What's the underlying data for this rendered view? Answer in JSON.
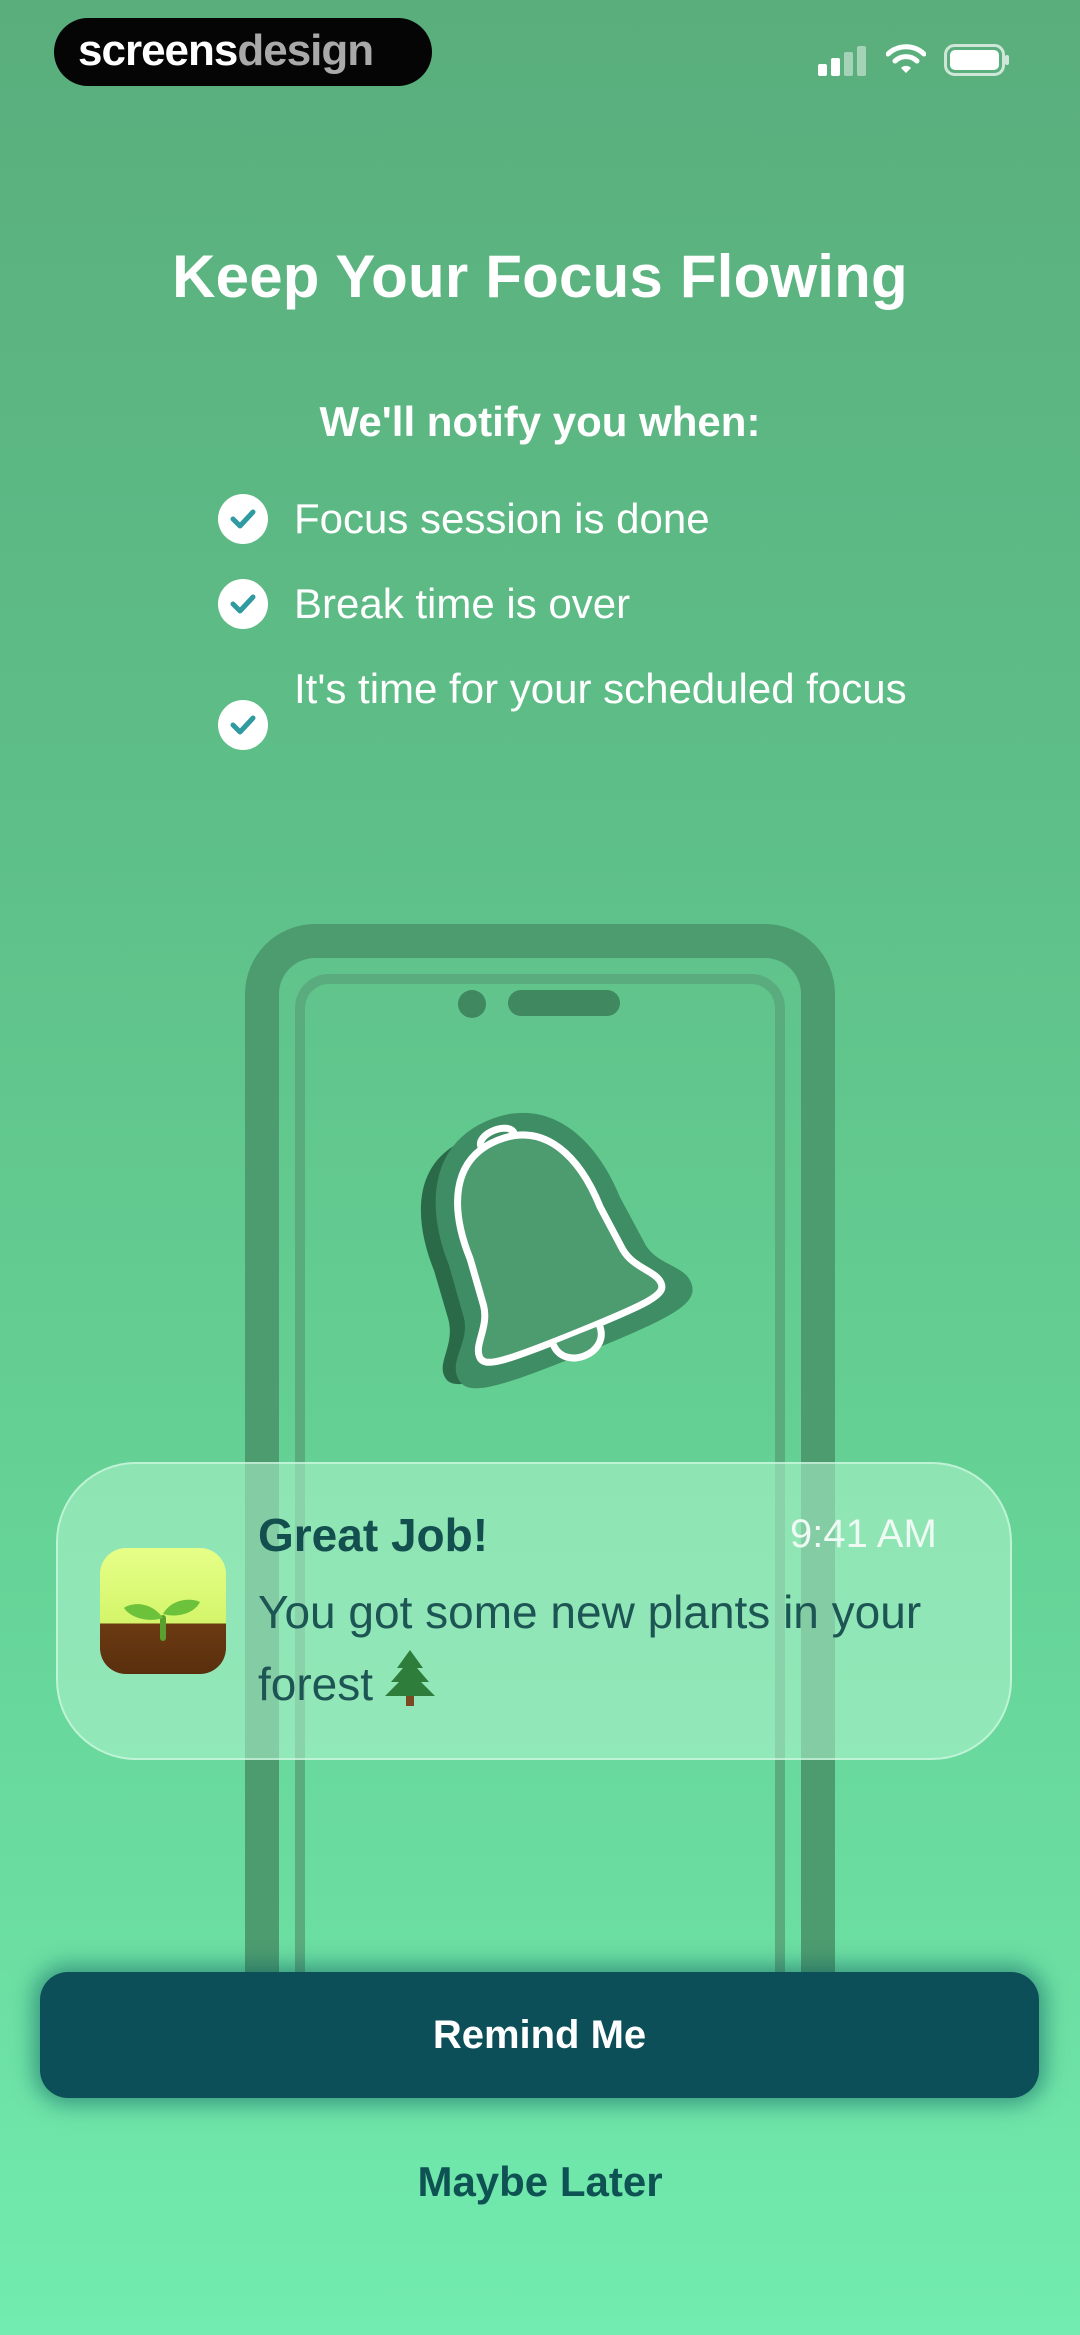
{
  "watermark": {
    "brand_text": "screensdesign"
  },
  "status_bar": {
    "signal_icon": "signal-icon",
    "wifi_icon": "wifi-icon",
    "battery_icon": "battery-icon"
  },
  "header": {
    "title": "Keep Your Focus Flowing",
    "subtitle": "We'll notify you when:"
  },
  "notify_list": [
    {
      "label": "Focus session is done",
      "icon": "checkmark-icon"
    },
    {
      "label": "Break time is over",
      "icon": "checkmark-icon"
    },
    {
      "label": "It's time for your scheduled focus",
      "icon": "checkmark-icon"
    }
  ],
  "illustration": {
    "icon": "bell-icon"
  },
  "notification": {
    "title": "Great Job!",
    "time": "9:41 AM",
    "body": "You got some new plants in your forest",
    "app_icon": "sprout-icon",
    "trailing_icon": "tree-icon"
  },
  "actions": {
    "primary_label": "Remind Me",
    "secondary_label": "Maybe Later"
  },
  "colors": {
    "background_top": "#5aae7c",
    "background_bottom": "#72ecb0",
    "primary_button": "#0c4f58",
    "secondary_text": "#0e5253",
    "check_mark": "#2f9aa0"
  }
}
